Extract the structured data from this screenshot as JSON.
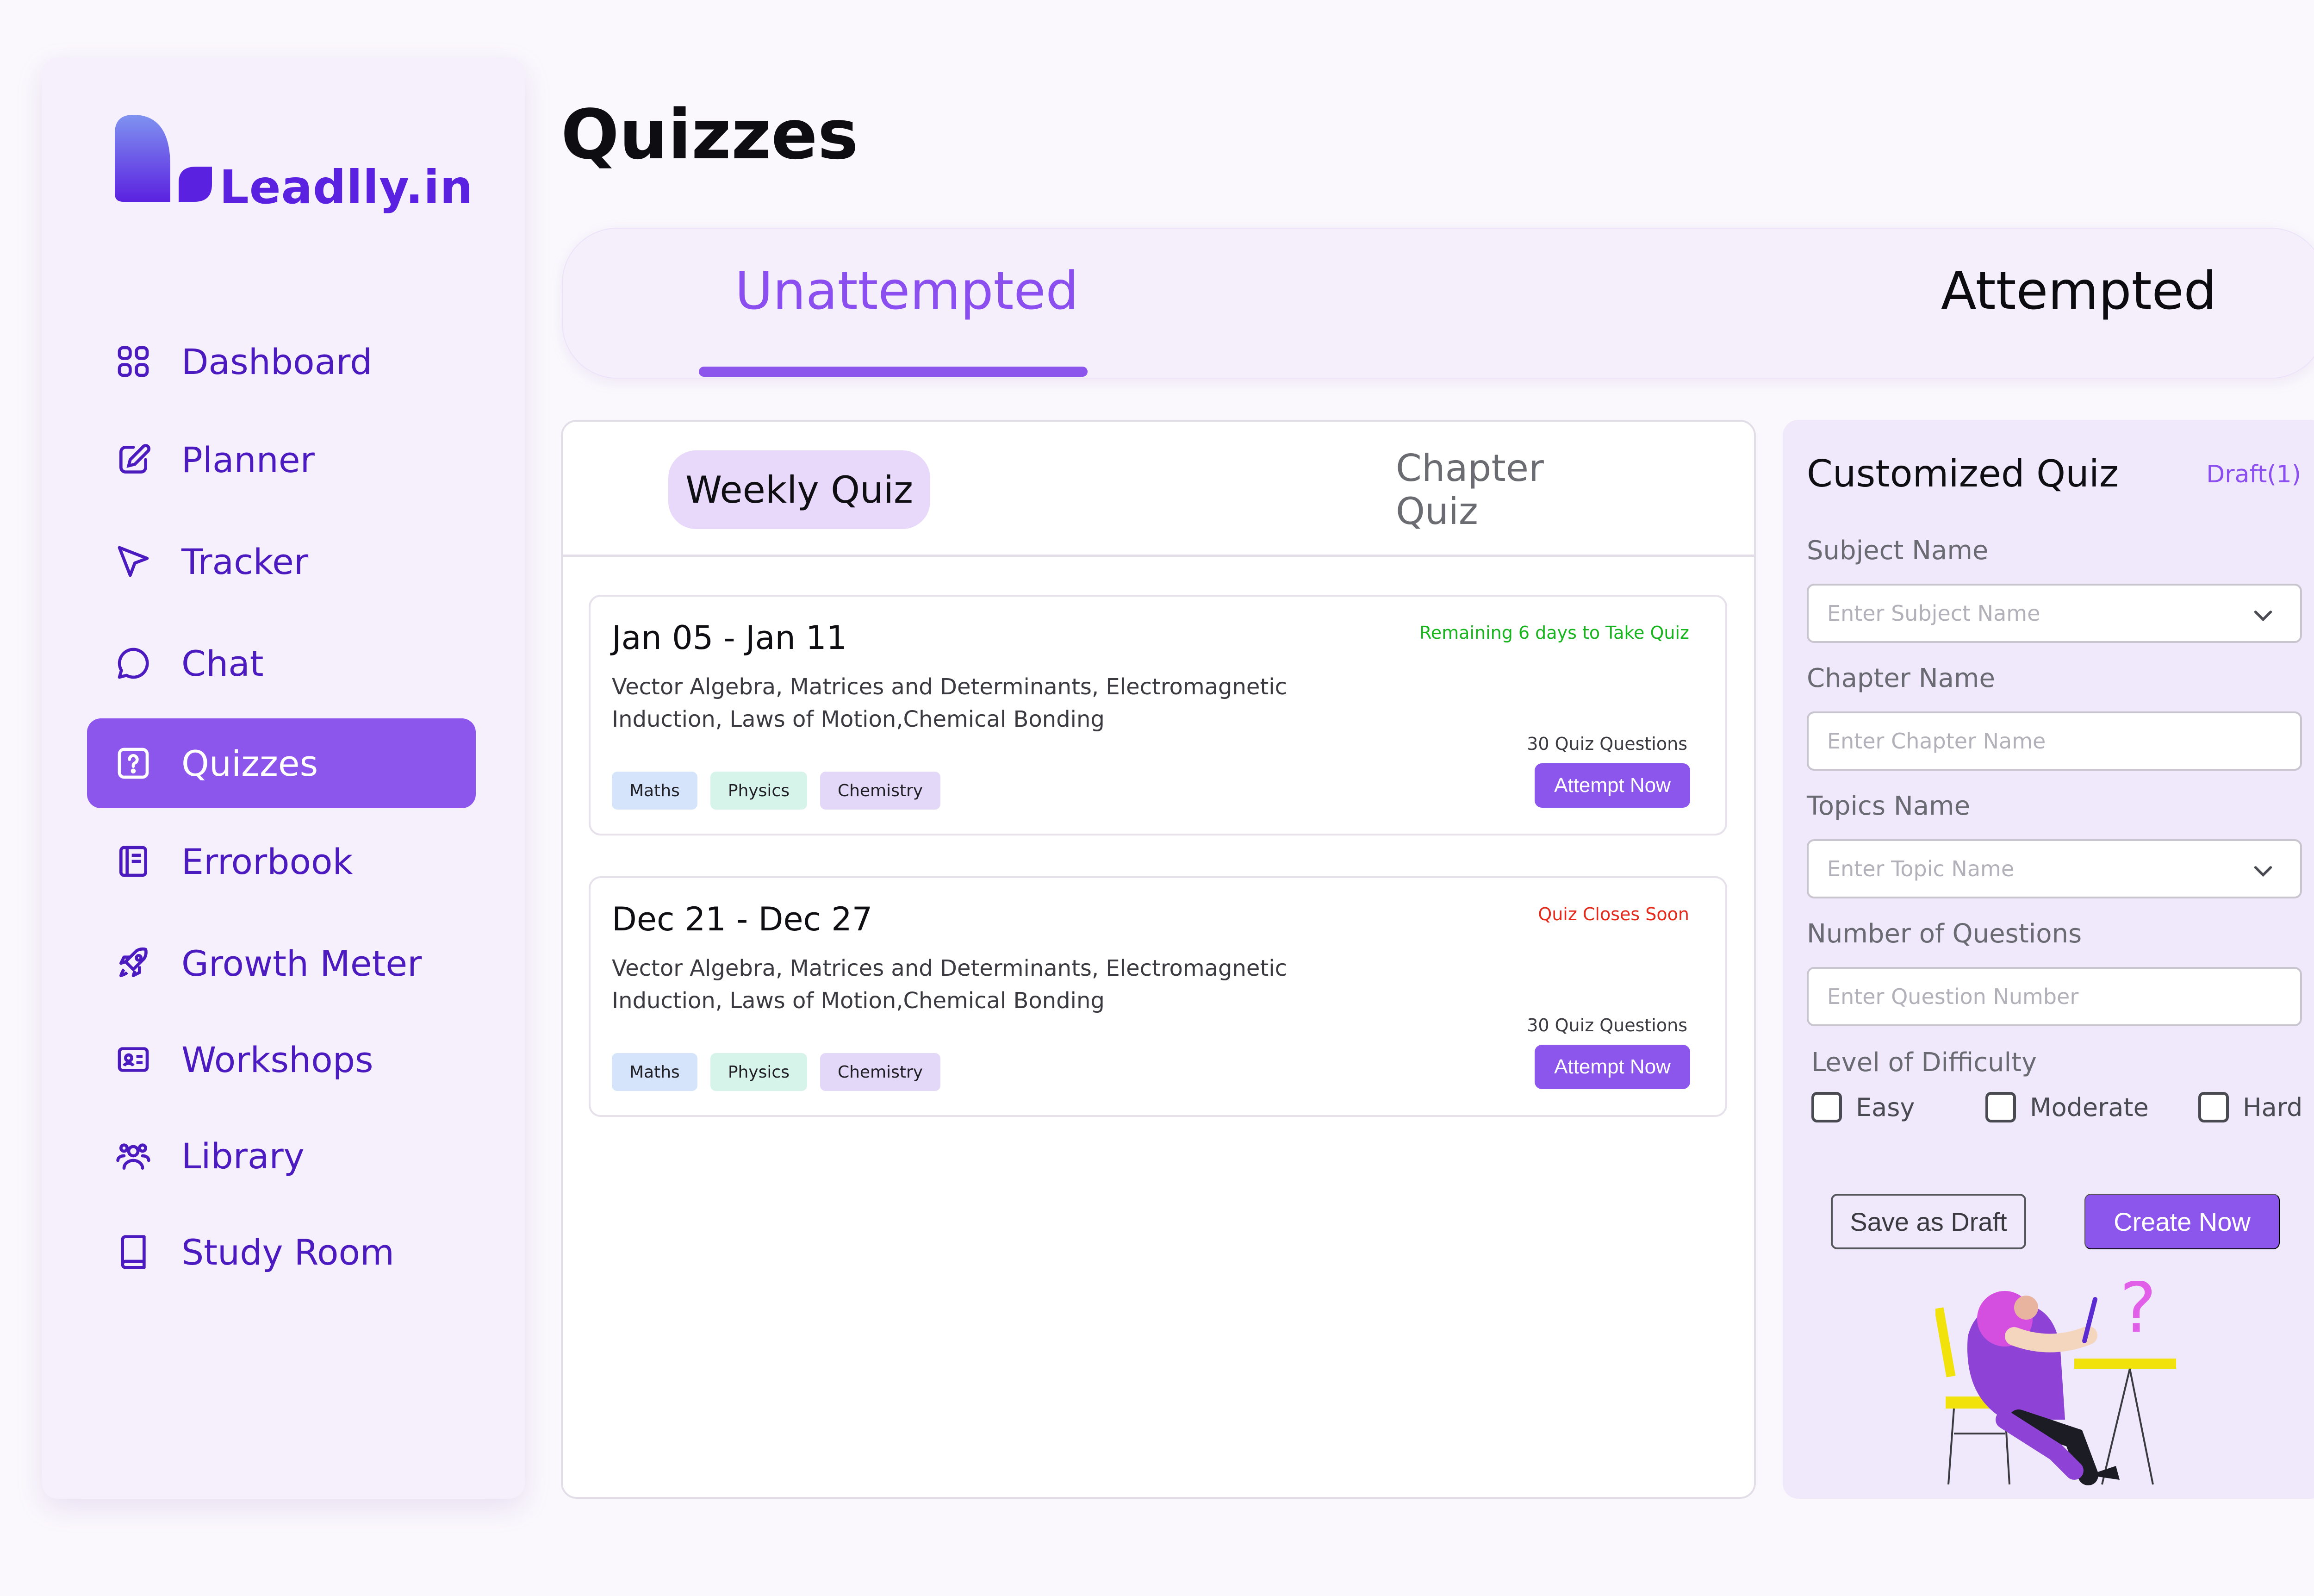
{
  "brand": {
    "name": "Leadlly.in",
    "color": "#5b21e0"
  },
  "sidebar": {
    "items": [
      {
        "label": "Dashboard",
        "icon": "dashboard-grid-icon"
      },
      {
        "label": "Planner",
        "icon": "edit-icon"
      },
      {
        "label": "Tracker",
        "icon": "send-icon"
      },
      {
        "label": "Chat",
        "icon": "chat-bubble-icon"
      },
      {
        "label": "Quizzes",
        "icon": "question-box-icon",
        "active": true
      },
      {
        "label": "Errorbook",
        "icon": "notebook-icon"
      },
      {
        "label": "Growth Meter",
        "icon": "rocket-icon"
      },
      {
        "label": "Workshops",
        "icon": "id-card-icon"
      },
      {
        "label": "Library",
        "icon": "users-icon"
      },
      {
        "label": "Study Room",
        "icon": "book-icon"
      }
    ]
  },
  "page": {
    "title": "Quizzes"
  },
  "main_tabs": [
    {
      "label": "Unattempted",
      "active": true
    },
    {
      "label": "Attempted",
      "active": false
    }
  ],
  "sub_tabs": [
    {
      "label": "Weekly Quiz",
      "active": true
    },
    {
      "label": "Chapter Quiz",
      "active": false
    }
  ],
  "quizzes": [
    {
      "range": "Jan 05 - Jan 11",
      "status": "Remaining 6 days to Take Quiz",
      "status_color": "#18b51f",
      "description": "Vector Algebra, Matrices and Determinants, Electromagnetic Induction, Laws of Motion,Chemical Bonding",
      "question_count": "30 Quiz Questions",
      "tags": [
        "Maths",
        "Physics",
        "Chemistry"
      ],
      "action": "Attempt Now"
    },
    {
      "range": "Dec 21 - Dec 27",
      "status": "Quiz Closes Soon",
      "status_color": "#e22b1c",
      "description": "Vector Algebra, Matrices and Determinants, Electromagnetic Induction, Laws of Motion,Chemical Bonding",
      "question_count": "30 Quiz Questions",
      "tags": [
        "Maths",
        "Physics",
        "Chemistry"
      ],
      "action": "Attempt Now"
    }
  ],
  "custom_quiz": {
    "title": "Customized Quiz",
    "draft": "Draft(1)",
    "subject": {
      "label": "Subject Name",
      "placeholder": "Enter Subject Name"
    },
    "chapter": {
      "label": "Chapter Name",
      "placeholder": "Enter Chapter Name"
    },
    "topics": {
      "label": "Topics Name",
      "placeholder": "Enter Topic Name"
    },
    "questions": {
      "label": "Number of Questions",
      "placeholder": "Enter Question Number"
    },
    "difficulty": {
      "label": "Level of Difficulty",
      "options": [
        "Easy",
        "Moderate",
        "Hard"
      ]
    },
    "save_label": "Save as Draft",
    "create_label": "Create Now"
  },
  "colors": {
    "accent": "#8c55ec",
    "sidebar_bg": "#f6f0fc",
    "panel_bg": "#f0e8fb"
  }
}
